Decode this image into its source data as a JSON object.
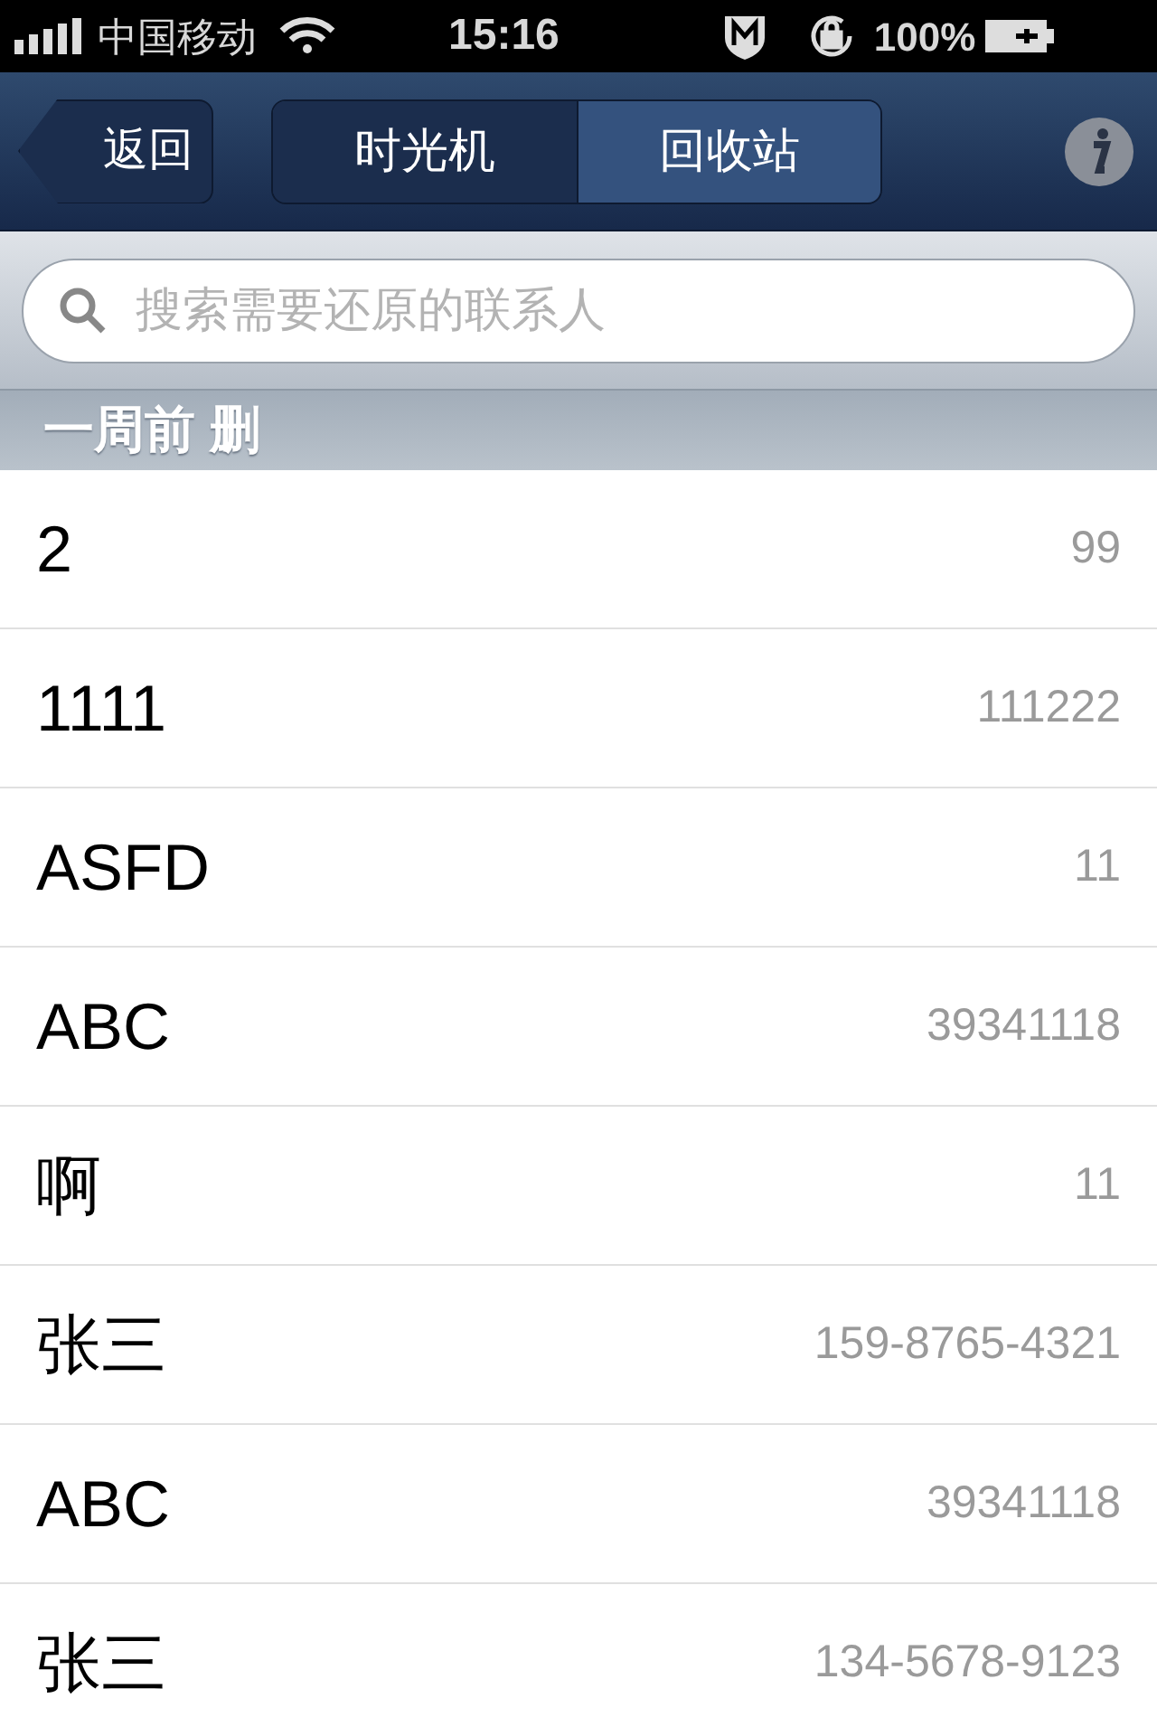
{
  "status_bar": {
    "carrier": "中国移动",
    "time": "15:16",
    "battery": "100%"
  },
  "nav": {
    "back": "返回",
    "tabs": [
      {
        "label": "时光机",
        "selected": false
      },
      {
        "label": "回收站",
        "selected": true
      }
    ]
  },
  "search": {
    "placeholder": "搜索需要还原的联系人"
  },
  "section": {
    "title": "一周前 删"
  },
  "contacts": [
    {
      "name": "2",
      "number": "99"
    },
    {
      "name": "1111",
      "number": "111222"
    },
    {
      "name": "ASFD",
      "number": "11"
    },
    {
      "name": "ABC",
      "number": "39341118"
    },
    {
      "name": "啊",
      "number": "11"
    },
    {
      "name": "张三",
      "number": "159-8765-4321"
    },
    {
      "name": "ABC",
      "number": "39341118"
    },
    {
      "name": "张三",
      "number": "134-5678-9123"
    }
  ]
}
